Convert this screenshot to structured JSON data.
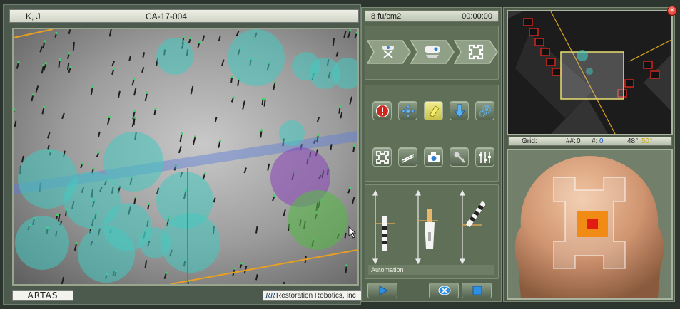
{
  "patient": {
    "name": "K, J",
    "case_id": "CA-17-004"
  },
  "status": {
    "dose": "8 fu/cm2",
    "timer": "00:00:00"
  },
  "brand": {
    "logo": "ARTAS",
    "company": "Restoration Robotics, Inc",
    "company_mark": "RR"
  },
  "panel": {
    "automation_label": "Automation"
  },
  "grid": {
    "label": "Grid:",
    "harvested_label": "##:",
    "harvested_value": "0",
    "count_label": "#:",
    "count_value": "0",
    "angle_value": "48",
    "angle_unit": "°",
    "extra_value": "50",
    "extra_unit": "°"
  },
  "icons": {
    "mode_buttons": [
      "harvest-mode-icon",
      "implant-mode-icon",
      "grid-mode-icon"
    ],
    "tools_row1": [
      "stop-icon",
      "move-icon",
      "highlight-icon",
      "down-arrow-icon",
      "gears-icon"
    ],
    "tools_row2": [
      "grid-tensioner-icon",
      "ruler-icon",
      "camera-icon",
      "key-icon",
      "sliders-icon"
    ],
    "controls": [
      "play-icon",
      "skip-icon",
      "stop-square-icon"
    ]
  },
  "colors": {
    "accent_cyan": "#46c8c0",
    "purple_target": "#8a4bb5",
    "green_target": "#58b84a",
    "panel_green": "#56654f",
    "highlight_yellow": "#e8e070",
    "button_blue": "#2f7fd0",
    "alert_red": "#d0251c",
    "orange_marker": "#ef8a1a"
  }
}
